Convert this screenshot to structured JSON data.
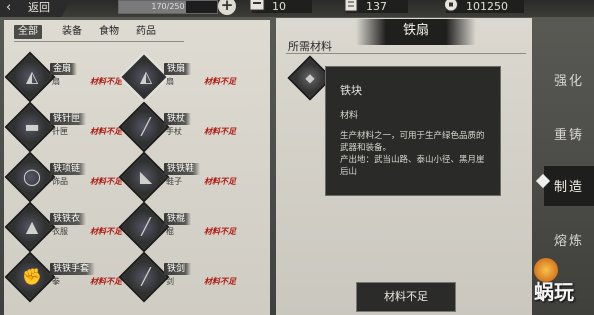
{
  "topbar": {
    "back_label": "返回",
    "stamina_text": "170/250",
    "stamina_fraction": 0.68,
    "plus_label": "+",
    "resources": [
      {
        "name": "bag",
        "value": "10"
      },
      {
        "name": "scroll",
        "value": "137"
      },
      {
        "name": "coin",
        "value": "101250"
      }
    ]
  },
  "tabs": [
    "全部",
    "装备",
    "食物",
    "药品"
  ],
  "items": [
    {
      "name": "金扇",
      "type": "扇",
      "not_enough": "材料不足",
      "icon": "fan-icon"
    },
    {
      "name": "铁扇",
      "type": "扇",
      "not_enough": "材料不足",
      "icon": "fan-icon",
      "selected": true
    },
    {
      "name": "铁针匣",
      "type": "针匣",
      "not_enough": "材料不足",
      "icon": "needle-case-icon"
    },
    {
      "name": "铁杖",
      "type": "手杖",
      "not_enough": "材料不足",
      "icon": "staff-icon"
    },
    {
      "name": "铁项链",
      "type": "饰品",
      "not_enough": "材料不足",
      "icon": "necklace-icon"
    },
    {
      "name": "铁铁鞋",
      "type": "鞋子",
      "not_enough": "材料不足",
      "icon": "shoe-icon"
    },
    {
      "name": "铁铁衣",
      "type": "衣服",
      "not_enough": "材料不足",
      "icon": "robe-icon"
    },
    {
      "name": "铁棍",
      "type": "棍",
      "not_enough": "材料不足",
      "icon": "staff-icon"
    },
    {
      "name": "铁铁手套",
      "type": "拳",
      "not_enough": "材料不足",
      "icon": "glove-icon"
    },
    {
      "name": "铁剑",
      "type": "剑",
      "not_enough": "材料不足",
      "icon": "sword-icon"
    }
  ],
  "detail": {
    "title": "铁扇",
    "required_label": "所需材料",
    "button_label": "材料不足"
  },
  "tooltip": {
    "name": "铁块",
    "type": "材料",
    "desc_line1": "生产材料之一，可用于生产绿色品质的武器和装备。",
    "desc_line2": "产出地：武当山路、泰山小径、黑月崖后山"
  },
  "side_tabs": [
    "强化",
    "重铸",
    "制造",
    "熔炼"
  ],
  "watermark": "蜗玩",
  "colors": {
    "not_enough_red": "#b01b12",
    "panel_bg": "#dbd8d0",
    "dark_bg": "#2a2b29"
  }
}
